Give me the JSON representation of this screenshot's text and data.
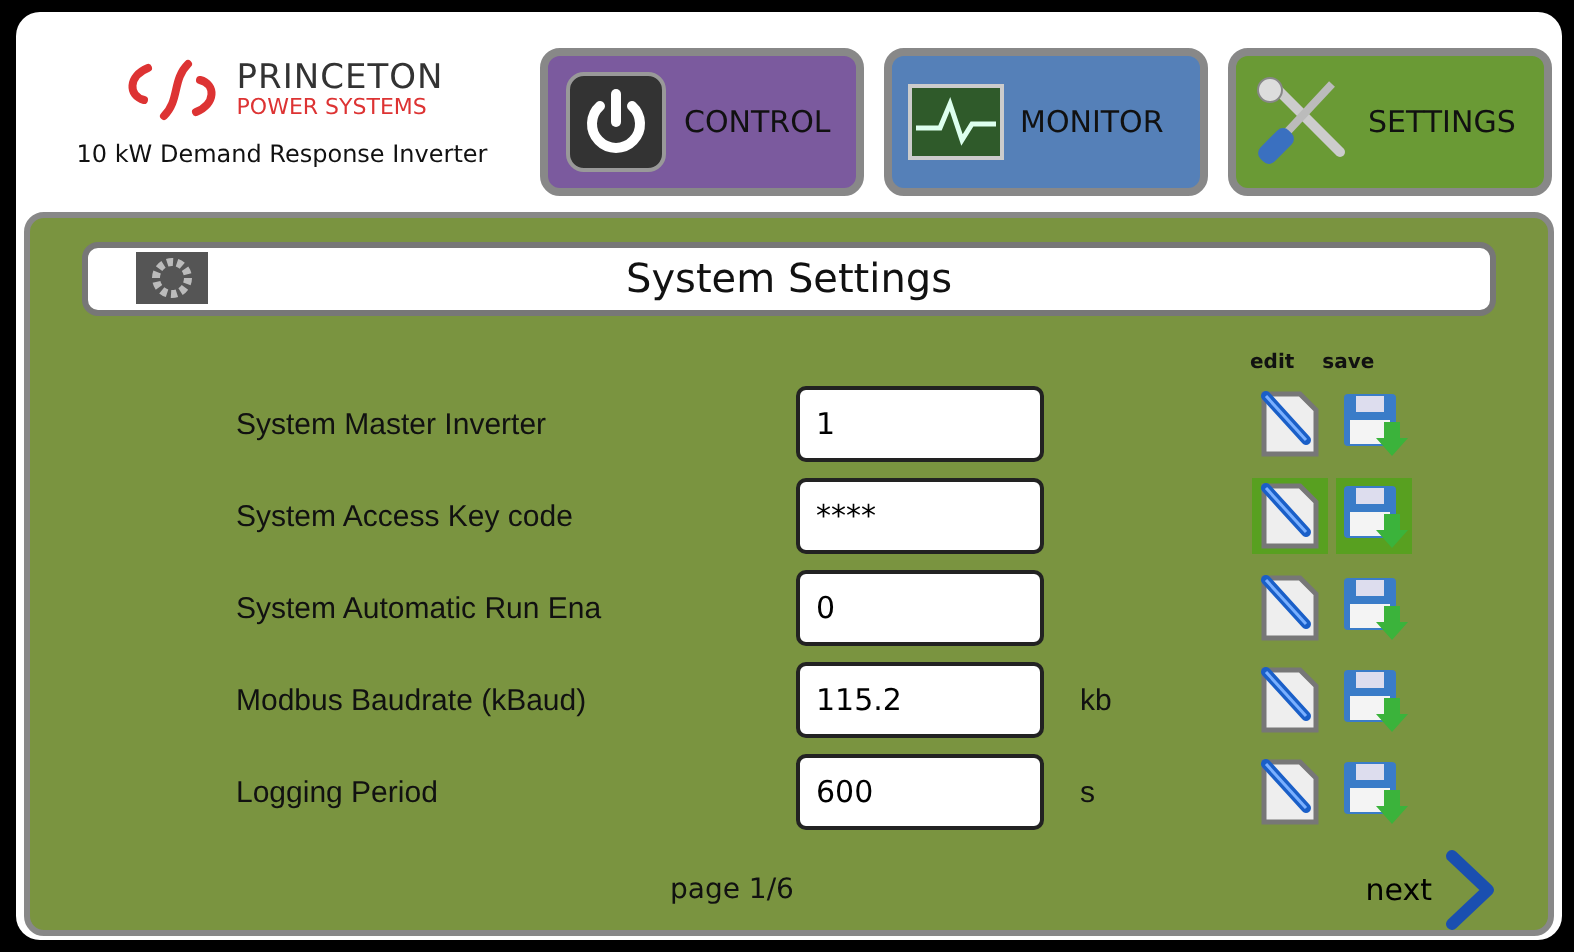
{
  "brand": {
    "name": "PRINCETON",
    "subtitle": "POWER SYSTEMS",
    "product": "10 kW Demand Response Inverter"
  },
  "nav": [
    {
      "kind": "power",
      "label": "CONTROL",
      "color": "#7b5a9e"
    },
    {
      "kind": "monitor",
      "label": "MONITOR",
      "color": "#5580b8"
    },
    {
      "kind": "tools",
      "label": "SETTINGS",
      "color": "#6a9a35"
    }
  ],
  "title": "System Settings",
  "column_headers": {
    "edit": "edit",
    "save": "save"
  },
  "settings": [
    {
      "label": "System Master Inverter",
      "value": "1",
      "highlighted": false
    },
    {
      "label": "System Access Key code",
      "value": "****",
      "highlighted": true
    },
    {
      "label": "System Automatic Run Ena",
      "value": "0",
      "highlighted": false
    },
    {
      "label": "Modbus Baudrate (kBaud)",
      "value": "115.2",
      "unit": "kb",
      "highlighted": false
    },
    {
      "label": "Logging Period",
      "value": "600",
      "unit": "s",
      "highlighted": false
    }
  ],
  "footer": {
    "page": "page 1/6",
    "next": "next"
  }
}
